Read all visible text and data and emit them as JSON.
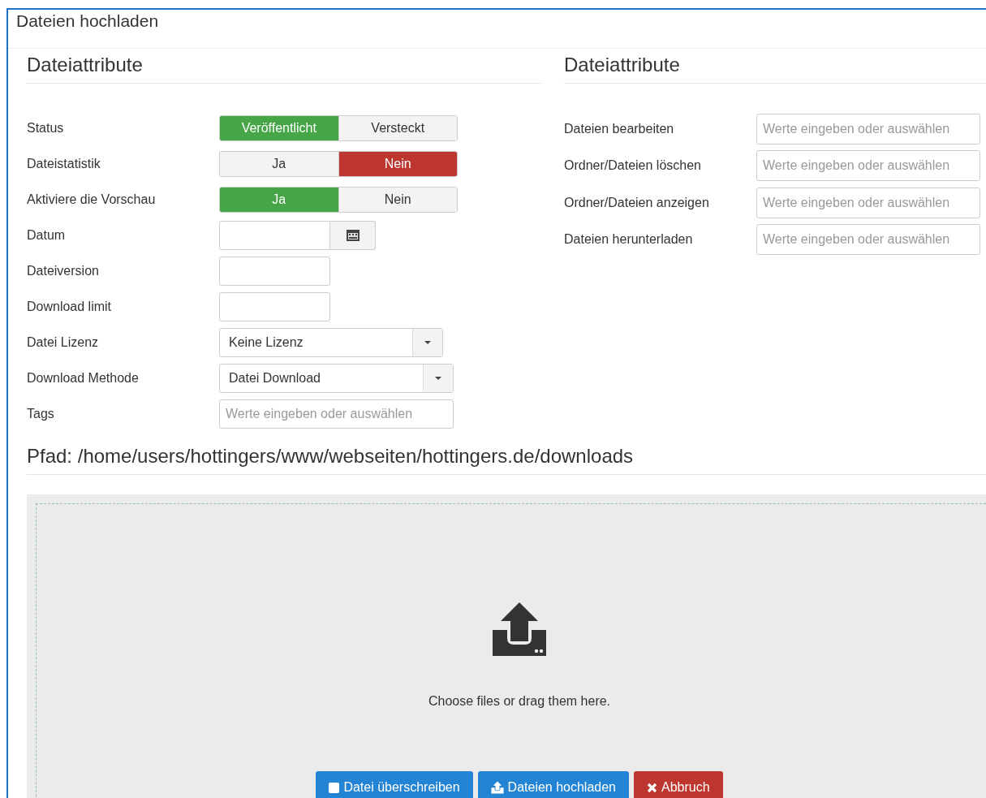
{
  "window": {
    "title": "Dateien hochladen"
  },
  "left_section": {
    "title": "Dateiattribute",
    "rows": [
      {
        "kind": "toggle",
        "label": "Status",
        "options": [
          {
            "label": "Veröffentlicht",
            "selected": true,
            "kind": "positive"
          },
          {
            "label": "Versteckt",
            "selected": false
          }
        ]
      },
      {
        "kind": "toggle",
        "label": "Dateistatistik",
        "options": [
          {
            "label": "Ja",
            "selected": false
          },
          {
            "label": "Nein",
            "selected": true,
            "kind": "negative"
          }
        ]
      },
      {
        "kind": "toggle",
        "label": "Aktiviere die Vorschau",
        "options": [
          {
            "label": "Ja",
            "selected": true,
            "kind": "positive"
          },
          {
            "label": "Nein",
            "selected": false
          }
        ]
      },
      {
        "kind": "date",
        "label": "Datum"
      },
      {
        "kind": "text",
        "label": "Dateiversion"
      },
      {
        "kind": "text",
        "label": "Download limit"
      },
      {
        "kind": "select",
        "label": "Datei Lizenz",
        "value": "Keine Lizenz"
      },
      {
        "kind": "select",
        "label": "Download Methode",
        "value": "Datei Download"
      },
      {
        "kind": "tags",
        "label": "Tags",
        "placeholder": "Werte eingeben oder auswählen"
      }
    ]
  },
  "right_section": {
    "title": "Dateiattribute",
    "rows": [
      {
        "label": "Dateien bearbeiten",
        "placeholder": "Werte eingeben oder auswählen"
      },
      {
        "label": "Ordner/Dateien löschen",
        "placeholder": "Werte eingeben oder auswählen"
      },
      {
        "label": "Ordner/Dateien anzeigen",
        "placeholder": "Werte eingeben oder auswählen"
      },
      {
        "label": "Dateien herunterladen",
        "placeholder": "Werte eingeben oder auswählen"
      }
    ]
  },
  "path": "Pfad: /home/users/hottingers/www/webseiten/hottingers.de/downloads",
  "dropzone": {
    "text": "Choose files or drag them here."
  },
  "buttons": [
    {
      "kind": "checkbox",
      "label": "Datei überschreiben",
      "checked": false
    },
    {
      "kind": "upload",
      "label": "Dateien hochladen"
    },
    {
      "kind": "cancel",
      "label": "Abbruch"
    }
  ]
}
